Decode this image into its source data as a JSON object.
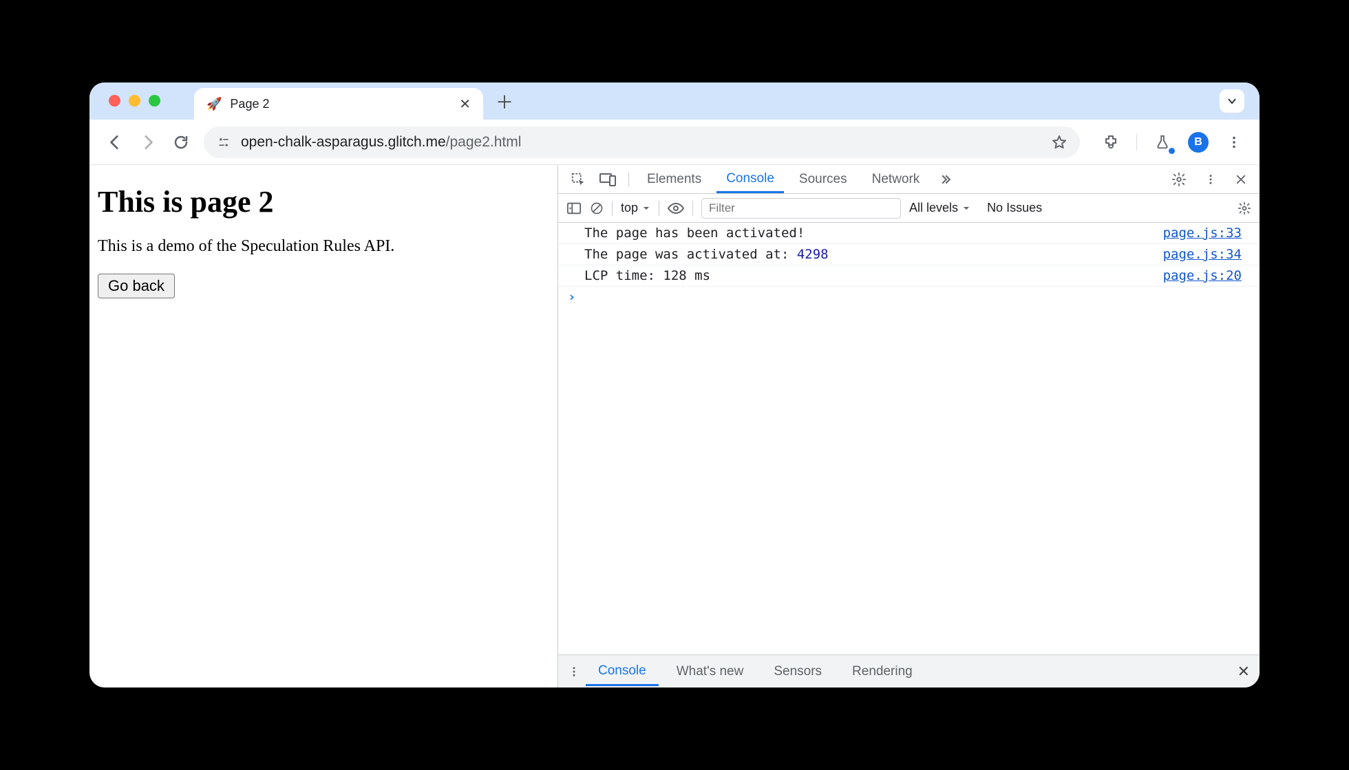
{
  "browser": {
    "tab_title": "Page 2",
    "tab_favicon": "🚀",
    "url_host": "open-chalk-asparagus.glitch.me",
    "url_path": "/page2.html",
    "avatar_letter": "B"
  },
  "page": {
    "heading": "This is page 2",
    "paragraph": "This is a demo of the Speculation Rules API.",
    "button": "Go back"
  },
  "devtools": {
    "tabs": [
      "Elements",
      "Console",
      "Sources",
      "Network"
    ],
    "active_tab": "Console",
    "context": "top",
    "filter_placeholder": "Filter",
    "levels_label": "All levels",
    "issues_label": "No Issues",
    "logs": [
      {
        "message": "The page has been activated!",
        "value": "",
        "source": "page.js:33"
      },
      {
        "message": "The page was activated at: ",
        "value": "4298",
        "source": "page.js:34"
      },
      {
        "message": "LCP time: 128 ms",
        "value": "",
        "source": "page.js:20"
      }
    ],
    "drawer_tabs": [
      "Console",
      "What's new",
      "Sensors",
      "Rendering"
    ],
    "drawer_active": "Console"
  }
}
